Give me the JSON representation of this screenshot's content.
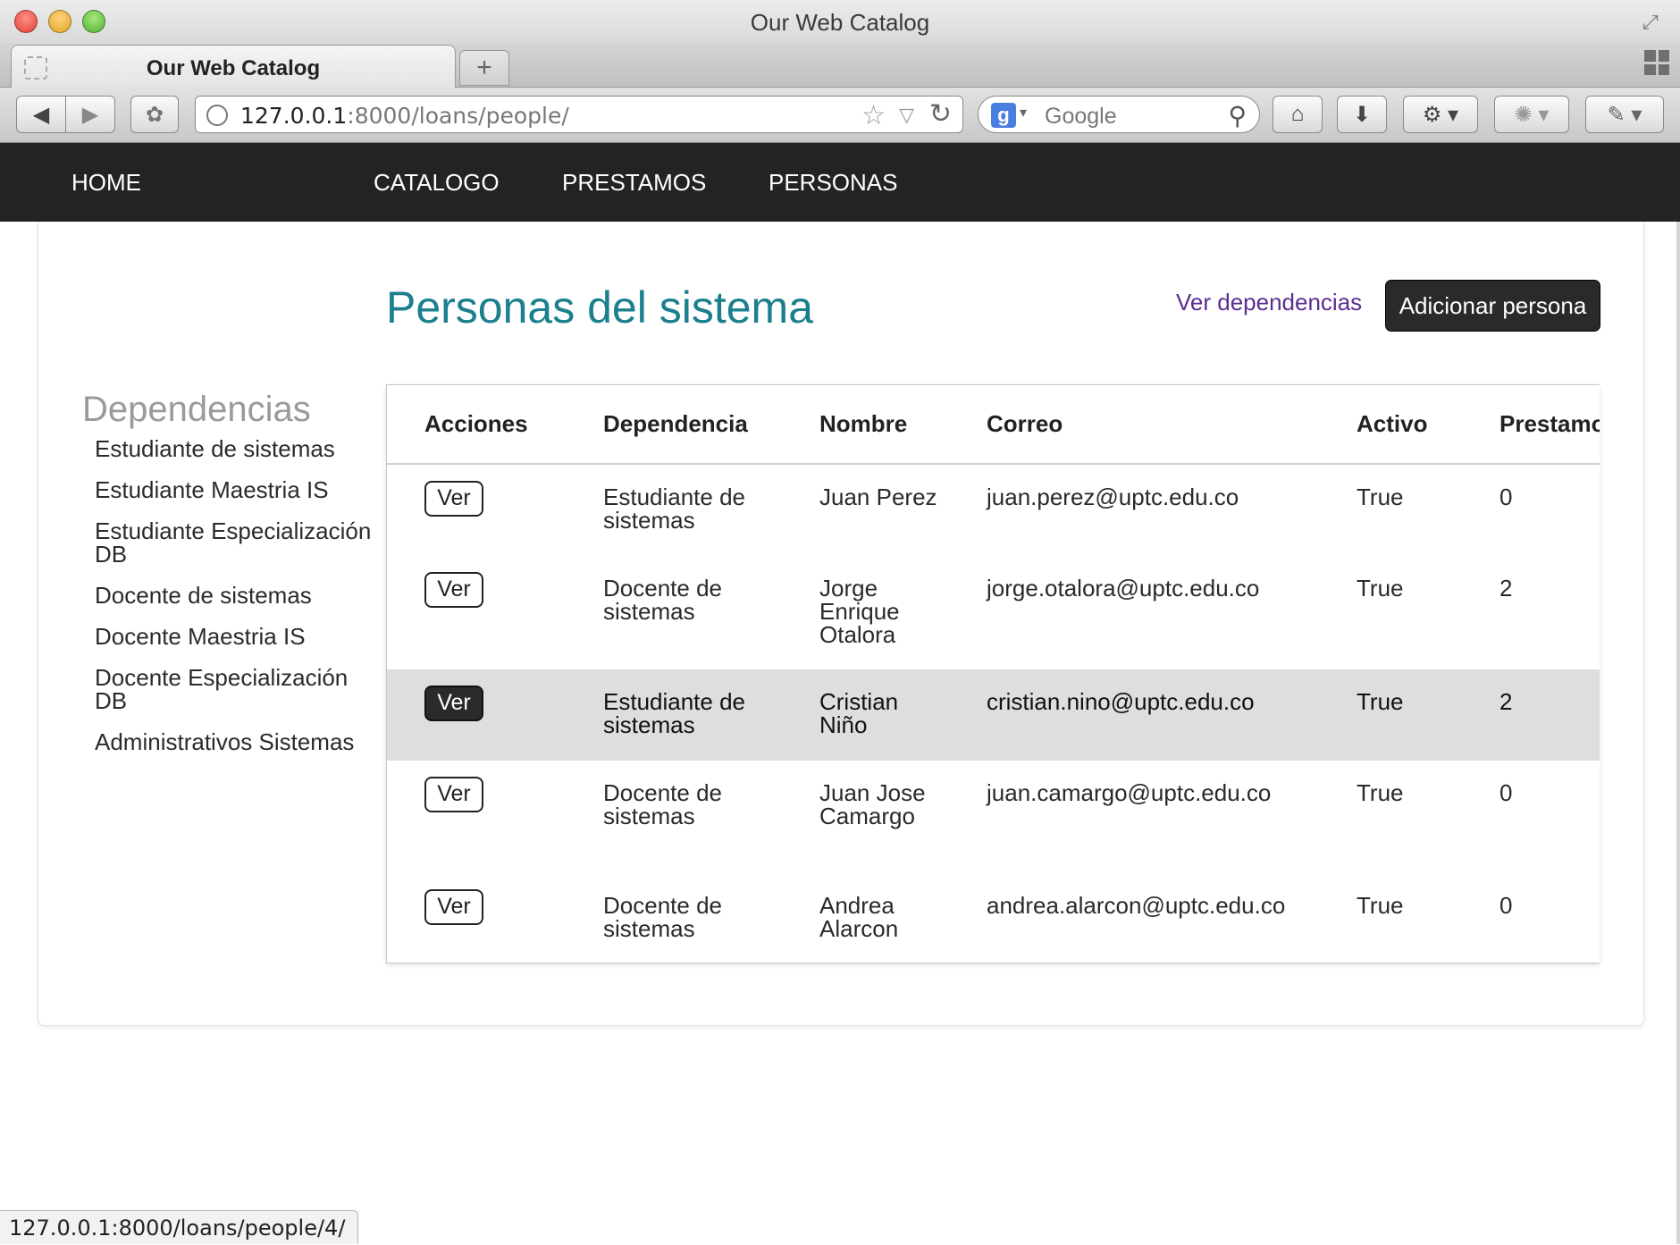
{
  "window": {
    "title": "Our Web Catalog"
  },
  "tabs": [
    {
      "label": "Our Web Catalog",
      "active": true
    }
  ],
  "new_tab_label": "+",
  "toolbar": {
    "url_host": "127.0.0.1",
    "url_rest": ":8000/loans/people/",
    "search_placeholder": "Google",
    "search_engine_letter": "g"
  },
  "nav": {
    "items": [
      {
        "label": "HOME"
      },
      {
        "label": "CATALOGO"
      },
      {
        "label": "PRESTAMOS"
      },
      {
        "label": "PERSONAS"
      }
    ]
  },
  "page": {
    "title": "Personas del sistema",
    "ver_dependencias": "Ver dependencias",
    "add_button": "Adicionar persona"
  },
  "sidebar": {
    "heading": "Dependencias",
    "items": [
      "Estudiante de sistemas",
      "Estudiante Maestria IS",
      "Estudiante Especialización DB",
      "Docente de sistemas",
      "Docente Maestria IS",
      "Docente Especialización DB",
      "Administrativos Sistemas"
    ]
  },
  "table": {
    "columns": [
      "Acciones",
      "Dependencia",
      "Nombre",
      "Correo",
      "Activo",
      "Prestamos"
    ],
    "action_label": "Ver",
    "rows": [
      {
        "dependencia": "Estudiante de sistemas",
        "nombre": "Juan Perez",
        "correo": "juan.perez@uptc.edu.co",
        "activo": "True",
        "prestamos": "0"
      },
      {
        "dependencia": "Docente de sistemas",
        "nombre": "Jorge Enrique Otalora",
        "correo": "jorge.otalora@uptc.edu.co",
        "activo": "True",
        "prestamos": "2"
      },
      {
        "dependencia": "Estudiante de sistemas",
        "nombre": "Cristian Niño",
        "correo": "cristian.nino@uptc.edu.co",
        "activo": "True",
        "prestamos": "2"
      },
      {
        "dependencia": "Docente de sistemas",
        "nombre": "Juan Jose Camargo",
        "correo": "juan.camargo@uptc.edu.co",
        "activo": "True",
        "prestamos": "0"
      },
      {
        "dependencia": "Docente de sistemas",
        "nombre": "Andrea Alarcon",
        "correo": "andrea.alarcon@uptc.edu.co",
        "activo": "True",
        "prestamos": "0"
      }
    ]
  },
  "status_bar": {
    "url": "127.0.0.1:8000/loans/people/4/"
  },
  "colors": {
    "accent": "#1b7f8e",
    "nav_bg": "#232323",
    "link_visited": "#5b2d91",
    "row_highlight": "#dedede"
  }
}
